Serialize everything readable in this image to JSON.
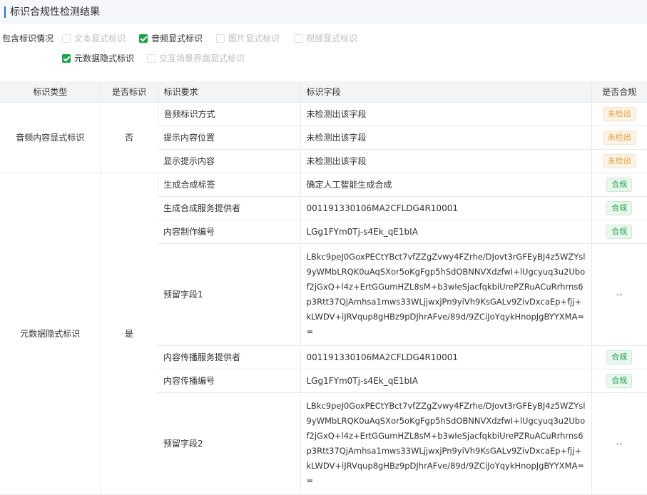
{
  "header": {
    "title": "标识合规性检测结果"
  },
  "filters": {
    "label": "包含标识情况",
    "options": [
      {
        "label": "文本显式标识",
        "checked": false
      },
      {
        "label": "音频显式标识",
        "checked": true
      },
      {
        "label": "图片显式标识",
        "checked": false
      },
      {
        "label": "视频显式标识",
        "checked": false
      },
      {
        "label": "元数据隐式标识",
        "checked": true
      },
      {
        "label": "交互场景界面显式标识",
        "checked": false
      }
    ]
  },
  "table": {
    "columns": [
      "标识类型",
      "是否标识",
      "标识要求",
      "标识字段",
      "是否合规"
    ],
    "groups": [
      {
        "type": "音频内容显式标识",
        "marked": "否",
        "rows": [
          {
            "requirement": "音频标识方式",
            "field": "未检测出该字段",
            "status": "未检出",
            "status_kind": "warn"
          },
          {
            "requirement": "提示内容位置",
            "field": "未检测出该字段",
            "status": "未检出",
            "status_kind": "warn"
          },
          {
            "requirement": "显示提示内容",
            "field": "未检测出该字段",
            "status": "未检出",
            "status_kind": "warn"
          }
        ]
      },
      {
        "type": "元数据隐式标识",
        "marked": "是",
        "rows": [
          {
            "requirement": "生成合成标签",
            "field": "确定人工智能生成合成",
            "status": "合规",
            "status_kind": "ok"
          },
          {
            "requirement": "生成合成服务提供者",
            "field": "001191330106MA2CFLDG4R10001",
            "status": "合规",
            "status_kind": "ok"
          },
          {
            "requirement": "内容制作编号",
            "field": "LGg1FYm0Tj-s4Ek_qE1bIA",
            "status": "合规",
            "status_kind": "ok"
          },
          {
            "requirement": "预留字段1",
            "field": "LBkc9peJ0GoxPECtYBct7vfZZgZvwy4FZrhe/DJovt3rGFEyBJ4z5WZYsl9yWMbLRQK0uAqSXor5oKgFgp5hSdOBNNVXdzfwI+lUgcyuq3u2Ubof2jGxQ+l4z+ErtGGumHZL8sM+b3wIeSjacfqkbiUrePZRuACuRrhrns6p3Rtt37QjAmhsa1mws33WLjjwxjPn9yiVh9KsGALv9ZivDxcaEp+fjj+kLWDV+iJRVqup8gHBz9pDJhrAFve/89d/9ZCiJoYqykHnopJgBYYXMA==",
            "status": "--",
            "status_kind": "none"
          },
          {
            "requirement": "内容传播服务提供者",
            "field": "001191330106MA2CFLDG4R10001",
            "status": "合规",
            "status_kind": "ok"
          },
          {
            "requirement": "内容传播编号",
            "field": "LGg1FYm0Tj-s4Ek_qE1bIA",
            "status": "合规",
            "status_kind": "ok"
          },
          {
            "requirement": "预留字段2",
            "field": "LBkc9peJ0GoxPECtYBct7vfZZgZvwy4FZrhe/DJovt3rGFEyBJ4z5WZYsl9yWMbLRQK0uAqSXor5oKgFgp5hSdOBNNVXdzfwI+lUgcyuq3u2Ubof2jGxQ+l4z+ErtGGumHZL8sM+b3wIeSjacfqkbiUrePZRuACuRrhrns6p3Rtt37QjAmhsa1mws33WLjjwxjPn9yiVh9KsGALv9ZivDxcaEp+fjj+kLWDV+iJRVqup8gHBz9pDJhrAFve/89d/9ZCiJoYqykHnopJgBYYXMA==",
            "status": "--",
            "status_kind": "none"
          }
        ]
      }
    ]
  },
  "colors": {
    "accent": "#1f6fff",
    "success": "#19a347",
    "warning": "#e6a23c"
  }
}
